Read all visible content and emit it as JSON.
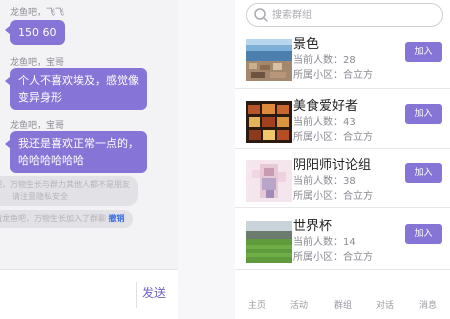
{
  "chat": {
    "messages": [
      {
        "sender": "龙鱼吧，飞飞",
        "text": "150 60"
      },
      {
        "sender": "龙鱼吧，宝哥",
        "line1": "个人不喜欢埃及，感觉像",
        "line2": "变异身形"
      },
      {
        "sender": "龙鱼吧，宝哥",
        "line1": "我还是喜欢正常一点的，",
        "line2": "哈哈哈哈哈哈"
      }
    ],
    "system_notice_1_line1": "吧，万物生长与群力其他人都不是朋友",
    "system_notice_1_line2": "请注意隐私安全",
    "system_notice_2": "请龙鱼吧，万物生长加入了群聊",
    "withdraw_label": "撤销",
    "send_label": "发送"
  },
  "search": {
    "placeholder": "搜索群组"
  },
  "groups": [
    {
      "name": "景色",
      "members": "当前人数：28",
      "community": "所属小区：合立方",
      "join_label": "加入",
      "thumb": "scenery-thumb"
    },
    {
      "name": "美食爱好者",
      "members": "当前人数：43",
      "community": "所属小区：合立方",
      "join_label": "加入",
      "thumb": "food-thumb"
    },
    {
      "name": "阴阳师讨论组",
      "members": "当前人数：38",
      "community": "所属小区：合立方",
      "join_label": "加入",
      "thumb": "game-thumb"
    },
    {
      "name": "世界杯",
      "members": "当前人数：14",
      "community": "所属小区：合立方",
      "join_label": "加入",
      "thumb": "stadium-thumb"
    }
  ],
  "nav": {
    "home": "主页",
    "activity": "活动",
    "groups": "群组",
    "chat": "对话",
    "messages": "消息"
  },
  "colors": {
    "accent": "#8675d6",
    "withdraw": "#3b6be0"
  }
}
